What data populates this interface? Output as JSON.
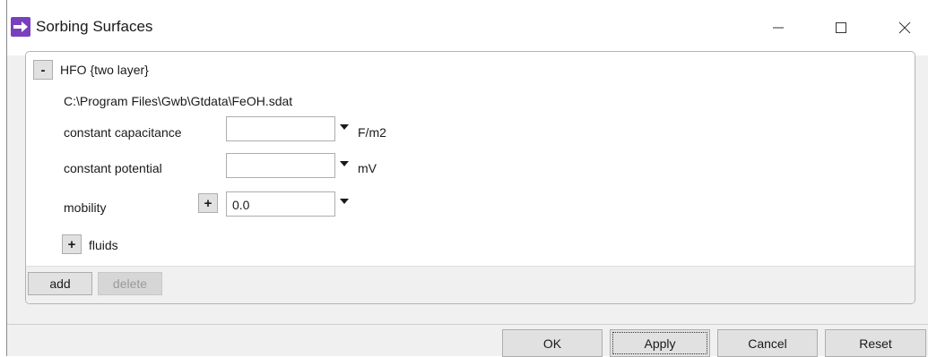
{
  "window": {
    "title": "Sorbing Surfaces",
    "controls": {
      "minimize": "minimize-icon",
      "maximize": "maximize-icon",
      "close": "close-icon"
    }
  },
  "surface": {
    "collapse_label": "-",
    "name": "HFO {two layer}",
    "path": "C:\\Program Files\\Gwb\\Gtdata\\FeOH.sdat",
    "fields": [
      {
        "label": "constant capacitance",
        "value": "",
        "unit": "F/m2"
      },
      {
        "label": "constant potential",
        "value": "",
        "unit": "mV"
      },
      {
        "label": "mobility",
        "expand_label": "+",
        "value": "0.0",
        "unit": ""
      }
    ],
    "fluids": {
      "expand_label": "+",
      "label": "fluids"
    }
  },
  "panel_footer": {
    "add_label": "add",
    "delete_label": "delete"
  },
  "buttons": {
    "ok": "OK",
    "apply": "Apply",
    "cancel": "Cancel",
    "reset": "Reset"
  }
}
